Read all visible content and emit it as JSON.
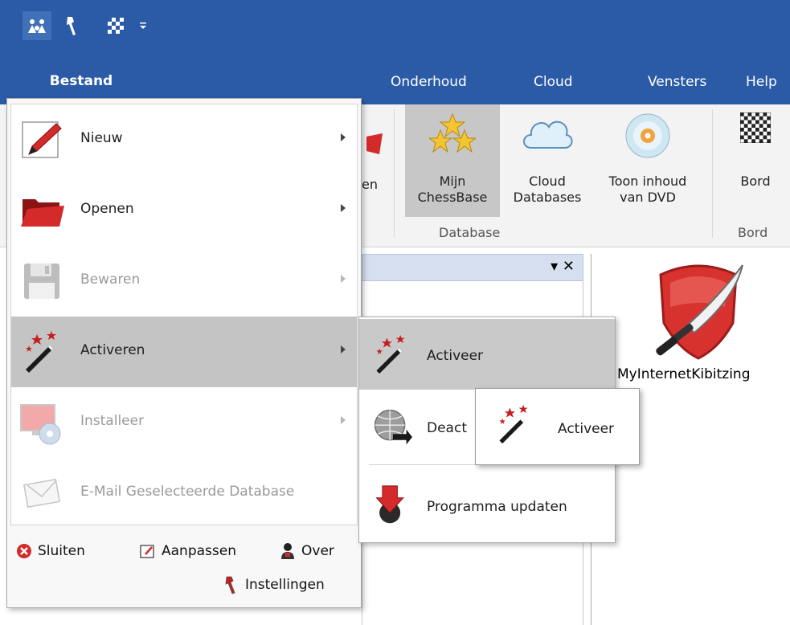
{
  "titlebar": {
    "qat": [
      "app-icon",
      "wrench-icon",
      "board-icon",
      "customize-qat-icon"
    ]
  },
  "ribbon": {
    "tabs": [
      "Onderhoud",
      "Cloud",
      "Vensters",
      "Help"
    ],
    "partial_button_label": "en",
    "buttons": {
      "mijn_chessbase": "Mijn\nChessBase",
      "cloud_databases": "Cloud\nDatabases",
      "toon_inhoud": "Toon inhoud\nvan DVD",
      "bord": "Bord"
    },
    "groups": {
      "database": "Database",
      "bord": "Bord"
    }
  },
  "pane": {
    "controls": "▾ ✕"
  },
  "content": {
    "kibitz_label": "MyInternetKibitzing"
  },
  "file_menu": {
    "tab_label": "Bestand",
    "items": [
      {
        "label": "Nieuw",
        "icon": "pencil-icon",
        "disabled": false
      },
      {
        "label": "Openen",
        "icon": "folder-icon",
        "disabled": false
      },
      {
        "label": "Bewaren",
        "icon": "floppy-icon",
        "disabled": true
      },
      {
        "label": "Activeren",
        "icon": "magic-wand-icon",
        "disabled": false,
        "highlighted": true
      },
      {
        "label": "Installeer",
        "icon": "monitor-dvd-icon",
        "disabled": true
      },
      {
        "label": "E-Mail Geselecteerde Database",
        "icon": "envelope-icon",
        "disabled": true
      }
    ],
    "footer": {
      "sluiten": "Sluiten",
      "aanpassen": "Aanpassen",
      "over": "Over",
      "instellingen": "Instellingen"
    }
  },
  "submenu": {
    "items": [
      {
        "label": "Activeer",
        "icon": "magic-wand-icon"
      },
      {
        "label": "Deact",
        "icon": "globe-icon"
      },
      {
        "label": "Programma updaten",
        "icon": "update-arrow-icon"
      }
    ]
  },
  "submenu2": {
    "label": "Activeer"
  },
  "colors": {
    "accent": "#2b5ba7",
    "highlight": "#c4c4c4",
    "disabled_text": "#9a9a9a"
  }
}
